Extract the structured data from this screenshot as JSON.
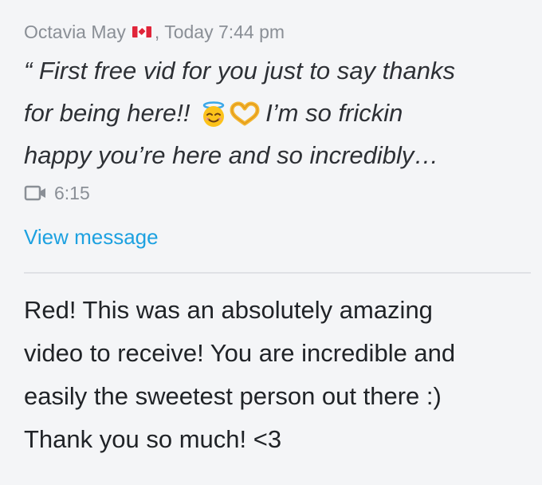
{
  "message": {
    "sender": "Octavia May",
    "flag_icon": "canada-flag-icon",
    "timestamp": ", Today 7:44 pm",
    "preview_lines": [
      "“ First free vid for you just to say thanks",
      "for being here!!",
      "I’m so frickin",
      "happy you’re here and so incredibly…"
    ],
    "emojis": [
      "smiling-face-with-halo-icon",
      "heart-hands-icon"
    ],
    "video_icon": "video-camera-icon",
    "video_duration": "6:15",
    "view_link": "View message"
  },
  "reply": {
    "lines": [
      "Red! This was an absolutely amazing",
      "video to receive! You are incredible and",
      "easily the sweetest person out there :)",
      "Thank you so much! <3"
    ]
  },
  "colors": {
    "background": "#f4f5f7",
    "meta_text": "#8a8f96",
    "link": "#1da1e0",
    "divider": "#dfe1e5"
  }
}
